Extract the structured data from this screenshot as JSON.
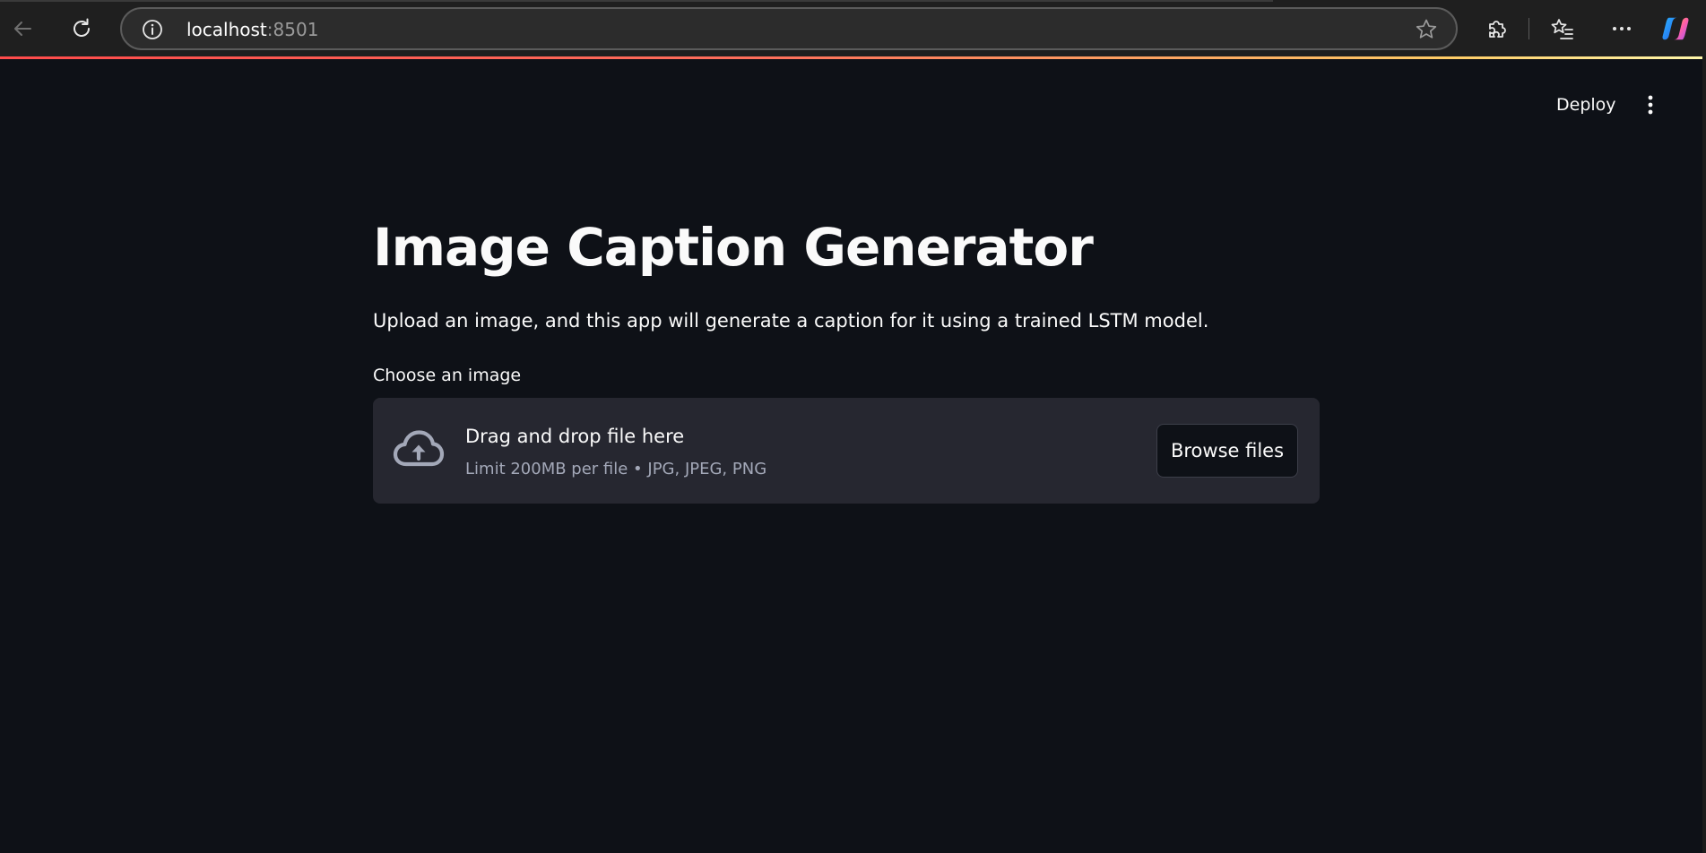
{
  "browser": {
    "url_host": "localhost",
    "url_port": ":8501",
    "icons": {
      "back": "back-arrow-icon",
      "refresh": "refresh-icon",
      "site_info": "info-icon",
      "favorite": "star-icon",
      "extensions": "puzzle-icon",
      "favorites": "favorites-list-icon",
      "more": "more-horizontal-icon",
      "copilot": "copilot-icon"
    }
  },
  "header": {
    "deploy_label": "Deploy",
    "menu_icon": "more-vertical-icon"
  },
  "main": {
    "title": "Image Caption Generator",
    "description": "Upload an image, and this app will generate a caption for it using a trained LSTM model.",
    "uploader": {
      "label": "Choose an image",
      "dropzone_title": "Drag and drop file here",
      "dropzone_hint": "Limit 200MB per file • JPG, JPEG, PNG",
      "browse_label": "Browse files",
      "icon": "cloud-upload-icon"
    }
  },
  "colors": {
    "background": "#0e1117",
    "dropzone": "#262730",
    "text": "#fafafa",
    "muted_text": "#a3a8b8",
    "accent_gradient_start": "#ff4b4b",
    "accent_gradient_end": "#fff7aa"
  }
}
